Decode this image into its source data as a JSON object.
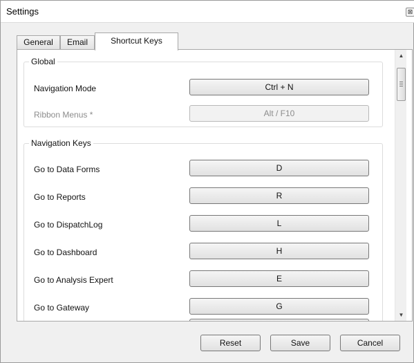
{
  "window": {
    "title": "Settings",
    "close_icon": "close-icon",
    "close_glyph": "⊠"
  },
  "tabs": [
    {
      "label": "General",
      "active": false
    },
    {
      "label": "Email",
      "active": false
    },
    {
      "label": "Shortcut Keys",
      "active": true
    }
  ],
  "global": {
    "title": "Global",
    "rows": [
      {
        "label": "Navigation Mode",
        "key": "Ctrl + N",
        "enabled": true
      },
      {
        "label": "Ribbon Menus *",
        "key": "Alt / F10",
        "enabled": false
      }
    ]
  },
  "navigation": {
    "title": "Navigation Keys",
    "rows": [
      {
        "label": "Go to Data Forms",
        "key": "D"
      },
      {
        "label": "Go to Reports",
        "key": "R"
      },
      {
        "label": "Go to DispatchLog",
        "key": "L"
      },
      {
        "label": "Go to Dashboard",
        "key": "H"
      },
      {
        "label": "Go to Analysis Expert",
        "key": "E"
      },
      {
        "label": "Go to Gateway",
        "key": "G"
      }
    ]
  },
  "scrollbar": {
    "up_glyph": "▲",
    "down_glyph": "▼"
  },
  "footer": {
    "reset_label": "Reset",
    "save_label": "Save",
    "cancel_label": "Cancel"
  }
}
